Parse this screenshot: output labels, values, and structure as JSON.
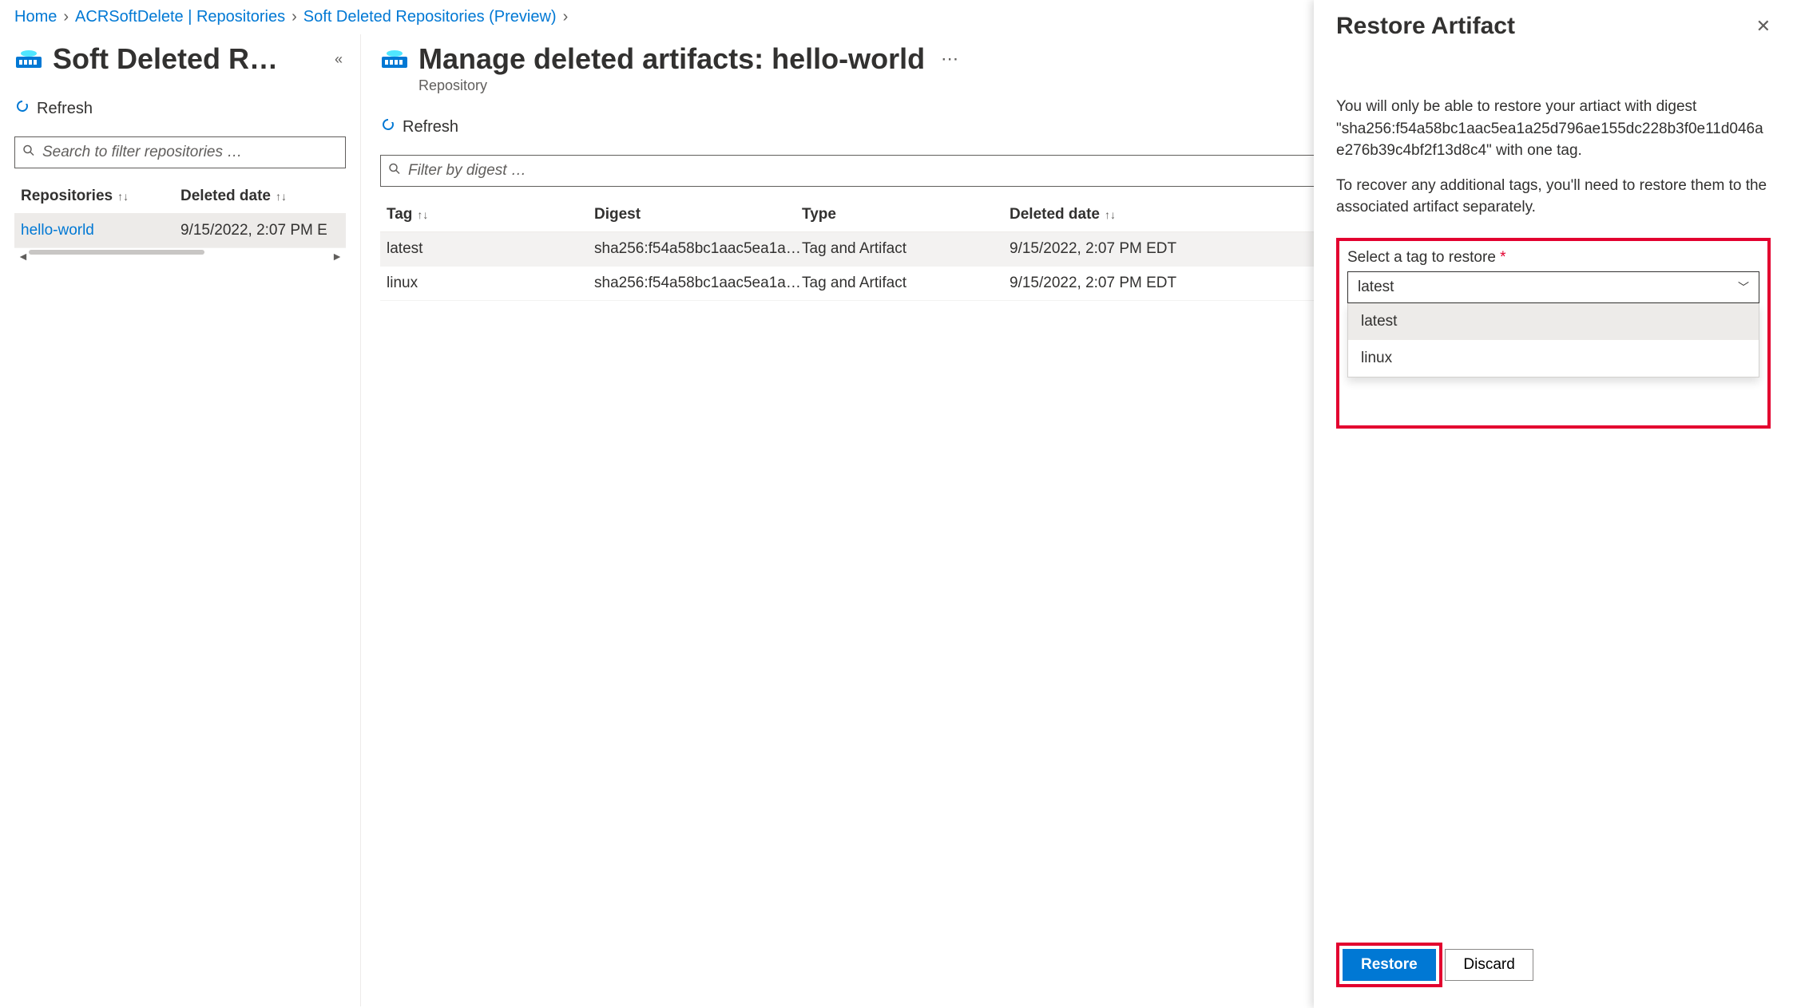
{
  "breadcrumb": [
    {
      "label": "Home"
    },
    {
      "label": "ACRSoftDelete | Repositories"
    },
    {
      "label": "Soft Deleted Repositories (Preview)"
    }
  ],
  "left": {
    "title": "Soft Deleted Re…",
    "refresh": "Refresh",
    "search_placeholder": "Search to filter repositories …",
    "columns": {
      "repo": "Repositories",
      "date": "Deleted date"
    },
    "rows": [
      {
        "name": "hello-world",
        "date": "9/15/2022, 2:07 PM E"
      }
    ]
  },
  "main": {
    "title": "Manage deleted artifacts: hello-world",
    "subtype": "Repository",
    "refresh": "Refresh",
    "filter_placeholder": "Filter by digest …",
    "columns": {
      "tag": "Tag",
      "digest": "Digest",
      "type": "Type",
      "date": "Deleted date"
    },
    "rows": [
      {
        "tag": "latest",
        "digest": "sha256:f54a58bc1aac5ea1a25…",
        "type": "Tag and Artifact",
        "date": "9/15/2022, 2:07 PM EDT",
        "selected": true
      },
      {
        "tag": "linux",
        "digest": "sha256:f54a58bc1aac5ea1a25…",
        "type": "Tag and Artifact",
        "date": "9/15/2022, 2:07 PM EDT",
        "selected": false
      }
    ]
  },
  "side": {
    "title": "Restore Artifact",
    "desc1": "You will only be able to restore your artiact with digest \"sha256:f54a58bc1aac5ea1a25d796ae155dc228b3f0e11d046ae276b39c4bf2f13d8c4\" with one tag.",
    "desc2": "To recover any additional tags, you'll need to restore them to the associated artifact separately.",
    "select_label": "Select a tag to restore",
    "selected_value": "latest",
    "options": [
      "latest",
      "linux"
    ],
    "restore": "Restore",
    "discard": "Discard"
  }
}
